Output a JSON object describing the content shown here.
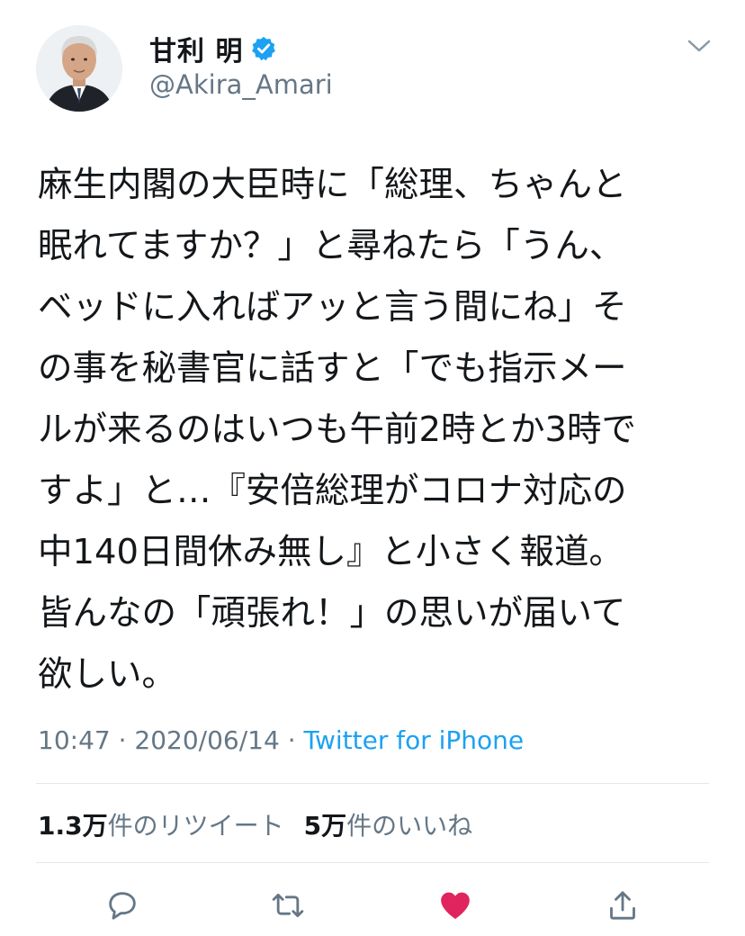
{
  "user": {
    "display_name": "甘利 明",
    "handle": "@Akira_Amari",
    "verified": true
  },
  "tweet": {
    "lines": [
      "麻生内閣の大臣時に「総理、ちゃんと",
      "眠れてますか？」と尋ねたら「うん、",
      "ベッドに入ればアッと言う間にね」そ",
      "の事を秘書官に話すと「でも指示メー",
      "ルが来るのはいつも午前2時とか3時で",
      "すよ」と…『安倍総理がコロナ対応の",
      "中140日間休み無し』と小さく報道。",
      "皆んなの「頑張れ！」の思いが届いて",
      "欲しい。"
    ]
  },
  "meta": {
    "time": "10:47",
    "separator": " · ",
    "date": "2020/06/14",
    "source": "Twitter for iPhone"
  },
  "stats": {
    "retweets_count": "1.3万",
    "retweets_label": "件のリツイート",
    "likes_count": "5万",
    "likes_label": "件のいいね"
  },
  "actions": {
    "reply_icon": "reply-icon",
    "retweet_icon": "retweet-icon",
    "like_icon": "heart-icon",
    "share_icon": "share-icon",
    "liked": true
  },
  "colors": {
    "text": "#14171a",
    "secondary": "#657786",
    "link": "#1da1f2",
    "like": "#e0245e",
    "divider": "#e1e8ed"
  }
}
